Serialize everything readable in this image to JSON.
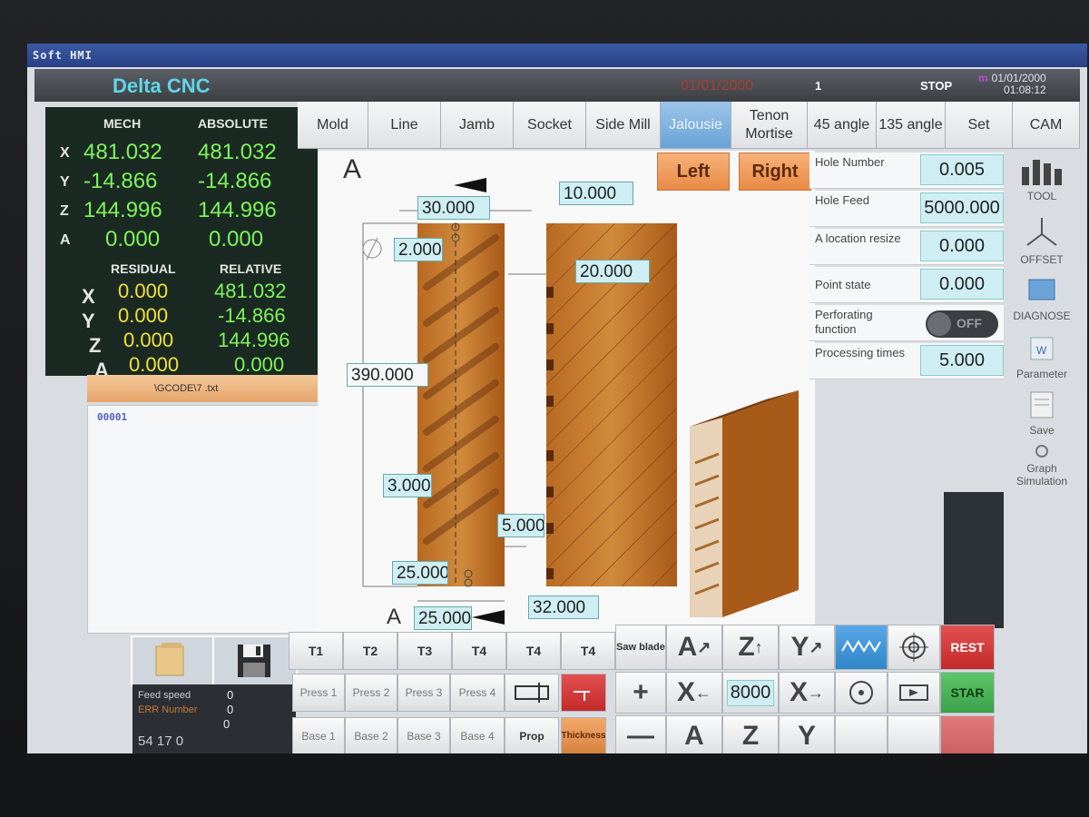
{
  "window_title": "Soft HMI",
  "header": {
    "brand": "Delta CNC",
    "date": "01/01/2000",
    "num": "1",
    "state": "STOP",
    "indicator": "m",
    "clock_date": "01/01/2000",
    "clock_time": "01:08:12"
  },
  "tabs": [
    "Mold",
    "Line",
    "Jamb",
    "Socket",
    "Side Mill",
    "Jalousie",
    "Tenon Mortise",
    "45 angle",
    "135 angle",
    "Set",
    "CAM"
  ],
  "active_tab": "Jalousie",
  "coords": {
    "mech_label": "MECH",
    "absolute_label": "ABSOLUTE",
    "residual_label": "RESIDUAL",
    "relative_label": "RELATIVE",
    "axes": [
      "X",
      "Y",
      "Z",
      "A"
    ],
    "mech": [
      "481.032",
      "-14.866",
      "144.996",
      "0.000"
    ],
    "absolute": [
      "481.032",
      "-14.866",
      "144.996",
      "0.000"
    ],
    "residual": [
      "0.000",
      "0.000",
      "0.000",
      "0.000"
    ],
    "relative": [
      "481.032",
      "-14.866",
      "144.996",
      "0.000"
    ]
  },
  "file_path": "\\GCODE\\7      .txt",
  "code_line": "00001",
  "status": {
    "feed_speed_label": "Feed speed",
    "feed_speed_value": "0",
    "err_label": "ERR Number",
    "err_value": "0",
    "third_value": "0",
    "time": "54 17 0"
  },
  "drawing": {
    "section_label": "A",
    "dims": {
      "top_width": "30.000",
      "top_gap": "10.000",
      "hole_dia": "2.000",
      "height": "390.000",
      "right_offset": "20.000",
      "slot": "3.000",
      "side": "5.000",
      "bottom": "25.000",
      "bottom_width": "25.000",
      "bottom_gap": "32.000"
    },
    "left_button": "Left",
    "right_button": "Right"
  },
  "params": [
    {
      "label": "Hole Number",
      "value": "0.005"
    },
    {
      "label": "Hole Feed",
      "value": "5000.000"
    },
    {
      "label": "A location resize",
      "value": "0.000"
    },
    {
      "label": "Point state",
      "value": "0.000"
    },
    {
      "label": "Perforating function",
      "value": "OFF"
    },
    {
      "label": "Processing times",
      "value": "5.000"
    }
  ],
  "right_tools": [
    "TOOL",
    "OFFSET",
    "DIAGNOSE",
    "Parameter",
    "Save",
    "Graph Simulation"
  ],
  "bottom": {
    "t_labels": [
      "T1",
      "T2",
      "T3",
      "T4",
      "T4",
      "T4"
    ],
    "saw": "Saw blade",
    "press": [
      "Press 1",
      "Press 2",
      "Press 3",
      "Press 4"
    ],
    "base": [
      "Base 1",
      "Base 2",
      "Base 3",
      "Base 4"
    ],
    "prop": "Prop",
    "thickness": "Thickness",
    "axis_a": "A",
    "axis_z": "Z",
    "axis_y": "Y",
    "axis_x": "X",
    "plus": "+",
    "minus": "—",
    "jog_value": "8000",
    "reset": "REST",
    "start": "STAR"
  },
  "colors": {
    "wood": "#c87a2c",
    "wood_dark": "#8a4a16",
    "accent_cyan": "#5fd6e8",
    "green_val": "#7ef35a",
    "yellow_val": "#f1e03c"
  }
}
